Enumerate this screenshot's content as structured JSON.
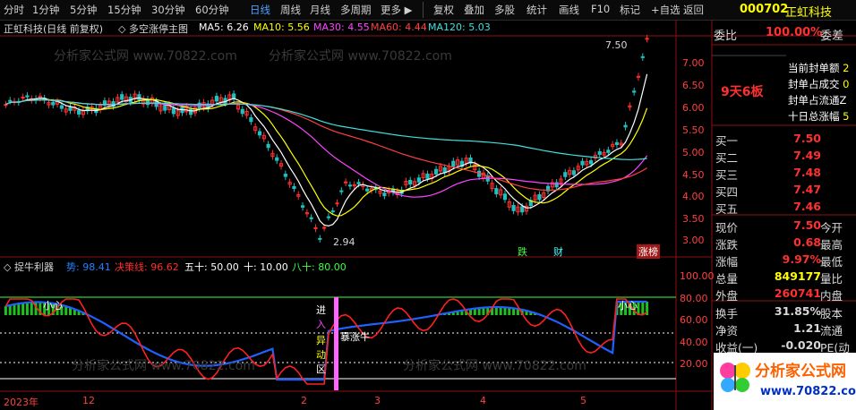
{
  "toolbar": {
    "items": [
      "分时",
      "1分钟",
      "5分钟",
      "15分钟",
      "30分钟",
      "60分钟",
      "日线",
      "周线",
      "月线",
      "多周期",
      "更多"
    ],
    "active_index": 6,
    "buttons": [
      "复权",
      "叠加",
      "多股",
      "统计",
      "画线",
      "F10",
      "标记",
      "+自选",
      "返回"
    ]
  },
  "stock": {
    "code": "000702",
    "name": "正虹科技"
  },
  "main_header": {
    "title": "正虹科技(日线 前复权)",
    "indicator": "多空涨停主图",
    "ma": [
      {
        "label": "MA5: 6.26",
        "color": "#ffffff"
      },
      {
        "label": "MA10: 5.56",
        "color": "#ffff00"
      },
      {
        "label": "MA30: 4.55",
        "color": "#ff44ff"
      },
      {
        "label": "MA60: 4.44",
        "color": "#ff4040"
      },
      {
        "label": "MA120: 5.03",
        "color": "#40e0e0"
      }
    ]
  },
  "price_axis": [
    "7.00",
    "6.50",
    "6.00",
    "5.50",
    "5.00",
    "4.50",
    "4.00",
    "3.50",
    "3.00"
  ],
  "annotations": {
    "high": "7.50",
    "low": "2.94",
    "boards": "9天6板",
    "jian": "跌",
    "cai": "财",
    "zhangbang": "涨榜"
  },
  "panel": [
    {
      "label": "当前封单额",
      "value": "2"
    },
    {
      "label": "封单占成交",
      "value": "0"
    },
    {
      "label": "封单占流通Z",
      "value": ""
    },
    {
      "label": "十日总涨幅",
      "value": "5"
    }
  ],
  "weibi": {
    "label": "委比",
    "value": "100.00%",
    "suffix": "委差"
  },
  "buy_orders": [
    {
      "name": "买一",
      "price": "7.50",
      "vol": ""
    },
    {
      "name": "买二",
      "price": "7.49",
      "vol": ""
    },
    {
      "name": "买三",
      "price": "7.48",
      "vol": ""
    },
    {
      "name": "买四",
      "price": "7.47",
      "vol": ""
    },
    {
      "name": "买五",
      "price": "7.46",
      "vol": ""
    }
  ],
  "stats": [
    {
      "l1": "现价",
      "v1": "7.50",
      "c1": "#ff3030",
      "l2": "今开"
    },
    {
      "l1": "涨跌",
      "v1": "0.68",
      "c1": "#ff3030",
      "l2": "最高"
    },
    {
      "l1": "涨幅",
      "v1": "9.97%",
      "c1": "#ff3030",
      "l2": "最低"
    },
    {
      "l1": "总量",
      "v1": "849177",
      "c1": "#ffff00",
      "l2": "量比"
    },
    {
      "l1": "外盘",
      "v1": "260741",
      "c1": "#ff3030",
      "l2": "内盘"
    }
  ],
  "stats2": [
    {
      "l1": "换手",
      "v1": "31.85%",
      "c1": "#d8d8d8",
      "l2": "股本"
    },
    {
      "l1": "净资",
      "v1": "1.21",
      "c1": "#d8d8d8",
      "l2": "流通"
    },
    {
      "l1": "收益(一)",
      "v1": "-0.020",
      "c1": "#d8d8d8",
      "l2": "PE(动"
    }
  ],
  "sub_header": {
    "name": "捉牛利器",
    "items": [
      {
        "label": "势: 98.41",
        "color": "#2080ff"
      },
      {
        "label": "决策线: 96.62",
        "color": "#ff3030"
      },
      {
        "label": "五十: 50.00",
        "color": "#ffffff"
      },
      {
        "label": "十: 10.00",
        "color": "#ffffff"
      },
      {
        "label": "八十: 80.00",
        "color": "#40ff40"
      }
    ]
  },
  "sub_axis": [
    "100.00",
    "80.00",
    "60.00",
    "40.00",
    "20.00"
  ],
  "sub_text": {
    "xiaoxin1": "小心",
    "xiaoxin2": "小心",
    "jinru": [
      "进",
      "入",
      "异",
      "动",
      "区"
    ],
    "baozhangniu": "暴涨牛"
  },
  "dates": [
    "2023年",
    "12",
    "2",
    "3",
    "4",
    "5"
  ],
  "watermark": "分析家公式网 www.70822.com",
  "logo": {
    "title": "分析家公式网",
    "url": "www.70822.com"
  }
}
